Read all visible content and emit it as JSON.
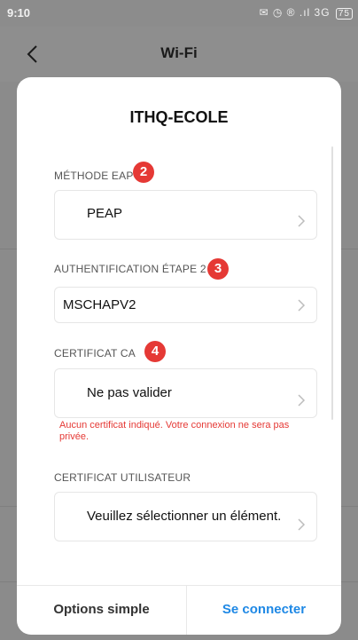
{
  "status_bar": {
    "time": "9:10",
    "icons_text": "✉ ◷ ® .ıl 3G",
    "battery": "75"
  },
  "app_bar": {
    "title": "Wi-Fi",
    "back_icon": "chevron-left-icon"
  },
  "dialog": {
    "title": "ITHQ-ECOLE",
    "sections": [
      {
        "label": "MÉTHODE EAP",
        "badge": "2",
        "value": "PEAP"
      },
      {
        "label": "AUTHENTIFICATION ÉTAPE 2",
        "badge": "3",
        "value": "MSCHAPV2"
      },
      {
        "label": "CERTIFICAT CA",
        "badge": "4",
        "value": "Ne pas valider"
      },
      {
        "label": "CERTIFICAT UTILISATEUR",
        "value": "Veuillez sélectionner un élément."
      }
    ],
    "warning": "Aucun certificat indiqué. Votre connexion ne sera pas privée.",
    "buttons": {
      "left": "Options simple",
      "right": "Se connecter"
    }
  },
  "colors": {
    "accent": "#1e88e5",
    "badge": "#e53935",
    "warning": "#e53935",
    "overlay": "#8b8b8b"
  }
}
